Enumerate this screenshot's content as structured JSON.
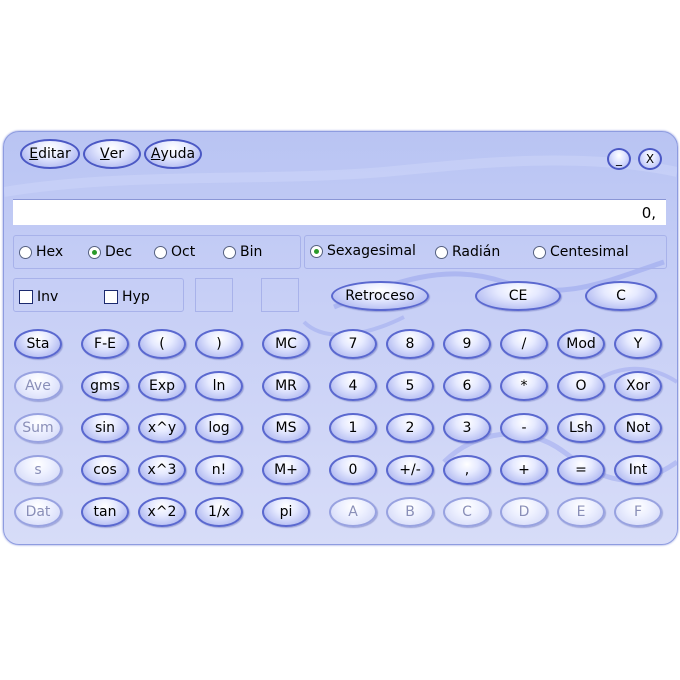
{
  "menu": {
    "editar": {
      "first": "E",
      "rest": "ditar"
    },
    "ver": {
      "first": "V",
      "rest": "er"
    },
    "ayuda": {
      "first": "A",
      "rest": "yuda"
    }
  },
  "window": {
    "minimize_label": "_",
    "close_label": "X"
  },
  "display": {
    "value": "0,"
  },
  "base": {
    "hex": "Hex",
    "dec": "Dec",
    "oct": "Oct",
    "bin": "Bin",
    "selected": "Dec"
  },
  "angle": {
    "sexagesimal": "Sexagesimal",
    "radian": "Radián",
    "centesimal": "Centesimal",
    "selected": "Sexagesimal"
  },
  "flags": {
    "inv": "Inv",
    "hyp": "Hyp"
  },
  "edit": {
    "backspace": "Retroceso",
    "ce": "CE",
    "c": "C"
  },
  "stats": {
    "sta": "Sta",
    "ave": "Ave",
    "sum": "Sum",
    "s": "s",
    "dat": "Dat"
  },
  "sci": {
    "fe": "F-E",
    "open_paren": "(",
    "close_paren": ")",
    "dms": "gms",
    "exp": "Exp",
    "ln": "ln",
    "sin": "sin",
    "pow": "x^y",
    "log": "log",
    "cos": "cos",
    "cube": "x^3",
    "fact": "n!",
    "tan": "tan",
    "square": "x^2",
    "recip": "1/x"
  },
  "memory": {
    "mc": "MC",
    "mr": "MR",
    "ms": "MS",
    "mplus": "M+",
    "pi": "pi"
  },
  "keypad": {
    "d7": "7",
    "d8": "8",
    "d9": "9",
    "div": "/",
    "d4": "4",
    "d5": "5",
    "d6": "6",
    "mul": "*",
    "d1": "1",
    "d2": "2",
    "d3": "3",
    "sub": "-",
    "d0": "0",
    "sign": "+/-",
    "dec": ",",
    "add": "+",
    "eq": "="
  },
  "logic": {
    "mod": "Mod",
    "and": "Y",
    "or": "O",
    "xor": "Xor",
    "lsh": "Lsh",
    "not": "Not",
    "int": "Int"
  },
  "hexdigits": {
    "a": "A",
    "b": "B",
    "c": "C",
    "d": "D",
    "e": "E",
    "f": "F"
  }
}
